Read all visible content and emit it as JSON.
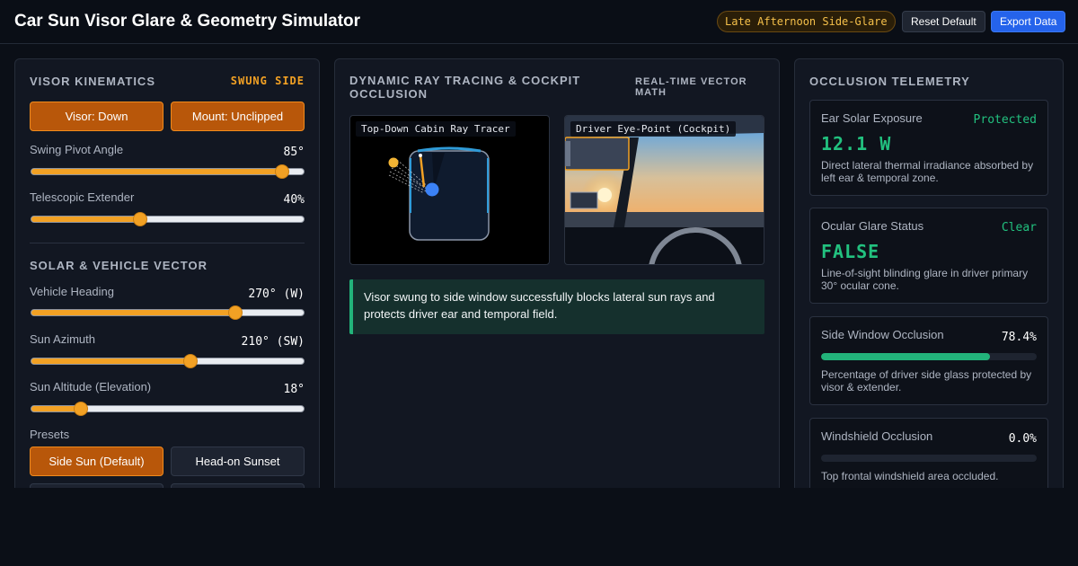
{
  "header": {
    "title": "Car Sun Visor Glare & Geometry Simulator",
    "scenario_badge": "Late Afternoon Side-Glare",
    "reset_label": "Reset Default",
    "export_label": "Export Data"
  },
  "left": {
    "kinematics_title": "VISOR KINEMATICS",
    "mode_badge": "SWUNG SIDE",
    "visor_button": "Visor: Down",
    "mount_button": "Mount: Unclipped",
    "swing": {
      "label": "Swing Pivot Angle",
      "value": "85°",
      "fraction": 0.92
    },
    "extender": {
      "label": "Telescopic Extender",
      "value": "40%",
      "fraction": 0.4
    },
    "solar_title": "SOLAR & VEHICLE VECTOR",
    "heading": {
      "label": "Vehicle Heading",
      "value": "270° (W)",
      "fraction": 0.75
    },
    "azimuth": {
      "label": "Sun Azimuth",
      "value": "210° (SW)",
      "fraction": 0.583
    },
    "altitude": {
      "label": "Sun Altitude (Elevation)",
      "value": "18°",
      "fraction": 0.18
    },
    "presets_label": "Presets",
    "presets": [
      "Side Sun (Default)",
      "Head-on Sunset"
    ]
  },
  "middle": {
    "title": "DYNAMIC RAY TRACING & COCKPIT OCCLUSION",
    "subtitle": "REAL-TIME VECTOR MATH",
    "topdown_label": "Top-Down Cabin Ray Tracer",
    "cockpit_label": "Driver Eye-Point (Cockpit)",
    "status_text": "Visor swung to side window successfully blocks lateral sun rays and protects driver ear and temporal field."
  },
  "right": {
    "title": "OCCLUSION TELEMETRY",
    "ear": {
      "label": "Ear Solar Exposure",
      "status": "Protected",
      "value": "12.1 W",
      "desc": "Direct lateral thermal irradiance absorbed by left ear & temporal zone."
    },
    "glare": {
      "label": "Ocular Glare Status",
      "status": "Clear",
      "value": "FALSE",
      "desc": "Line-of-sight blinding glare in driver primary 30° ocular cone."
    },
    "side_window": {
      "label": "Side Window Occlusion",
      "value": "78.4%",
      "fraction": 0.784,
      "desc": "Percentage of driver side glass protected by visor & extender."
    },
    "windshield": {
      "label": "Windshield Occlusion",
      "value": "0.0%",
      "fraction": 0.0,
      "desc": "Top frontal windshield area occluded."
    }
  },
  "colors": {
    "accent": "#f2a124",
    "success": "#22c17f",
    "primary": "#2563eb"
  }
}
